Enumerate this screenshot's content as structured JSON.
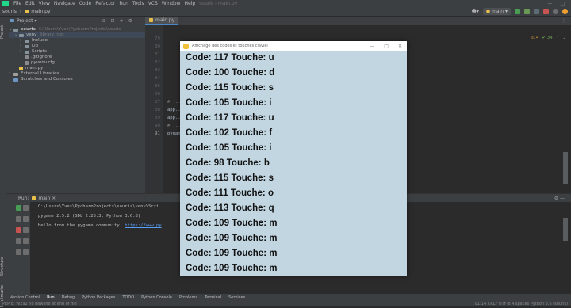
{
  "menubar": {
    "items": [
      "File",
      "Edit",
      "View",
      "Navigate",
      "Code",
      "Refactor",
      "Run",
      "Tools",
      "VCS",
      "Window",
      "Help"
    ],
    "project_title": "souris - main.py"
  },
  "navbar": {
    "project": "souris",
    "file": "main.py",
    "branch": "main"
  },
  "project_panel": {
    "title": "Project",
    "root_name": "souris",
    "root_path": "C:\\Users\\Yves\\PycharmProjects\\souris",
    "venv_name": "venv",
    "venv_note": "library root",
    "items": [
      "Include",
      "Lib",
      "Scripts",
      ".gitignore",
      "pyvenv.cfg",
      "main.py",
      "External Libraries",
      "Scratches and Consoles"
    ]
  },
  "editor": {
    "tab_label": "main.py",
    "line_numbers": [
      "79",
      "80",
      "81",
      "82",
      "83",
      "84",
      "85",
      "86",
      "87",
      "88",
      "89",
      "90",
      "91"
    ],
    "code_lines": [
      "# ...",
      "app....",
      "app...",
      "# ...",
      "pygam..."
    ],
    "warnings": "⚠ 4",
    "weak_warnings": "✔ 34"
  },
  "run_panel": {
    "title": "Run:",
    "config": "main",
    "console": [
      "C:\\Users\\Yves\\PycharmProjects\\souris\\venv\\Scri",
      "pygame 2.5.2 (SDL 2.28.3, Python 3.6.8)",
      "Hello from the pygame community. ",
      "https://www.py"
    ]
  },
  "bottom_tabs": [
    "Version Control",
    "Run",
    "Debug",
    "Python Packages",
    "TODO",
    "Python Console",
    "Problems",
    "Terminal",
    "Services"
  ],
  "statusbar": {
    "message": "PEP 8: W292 no newline at end of file",
    "right": "91:14  CRLF  UTF-8  4 spaces  Python 3.6 (souris)"
  },
  "pygame_window": {
    "title": "Affichage des codes et touches claviei",
    "lines": [
      "Code: 117   Touche: u",
      "Code: 100   Touche: d",
      "Code: 115   Touche: s",
      "Code: 105   Touche: i",
      "Code: 117   Touche: u",
      "Code: 102   Touche: f",
      "Code: 105   Touche: i",
      "Code: 98   Touche: b",
      "Code: 115   Touche: s",
      "Code: 111   Touche: o",
      "Code: 113   Touche: q",
      "Code: 109   Touche: m",
      "Code: 109   Touche: m",
      "Code: 109   Touche: m",
      "Code: 109   Touche: m"
    ],
    "background": "#c2d6e2"
  },
  "colors": {
    "accent": "#4a88c7",
    "run_green": "#499c54",
    "stop_red": "#c75450"
  }
}
